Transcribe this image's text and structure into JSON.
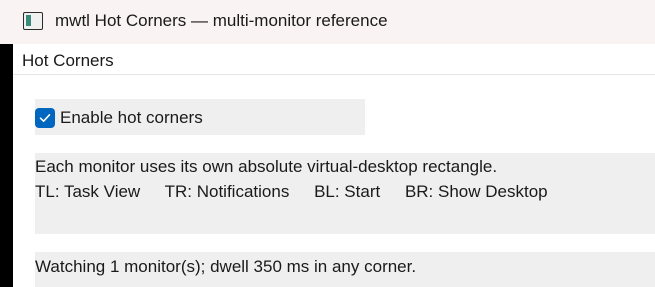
{
  "window": {
    "title": "mwtl Hot Corners — multi-monitor reference",
    "icon": "app-window-icon"
  },
  "section": {
    "header": "Hot Corners"
  },
  "settings": {
    "enable_label": "Enable hot corners",
    "enable_checked": true
  },
  "info": {
    "line1": "Each monitor uses its own absolute virtual-desktop rectangle.",
    "corners": [
      {
        "text": "TL: Task View"
      },
      {
        "text": "TR: Notifications"
      },
      {
        "text": "BL: Start"
      },
      {
        "text": "BR: Show Desktop"
      }
    ]
  },
  "status": {
    "text": "Watching 1 monitor(s); dwell 350 ms in any corner."
  },
  "colors": {
    "titlebar_bg": "#f9f3f3",
    "accent": "#0067c0",
    "panel_bg": "#efefef"
  }
}
